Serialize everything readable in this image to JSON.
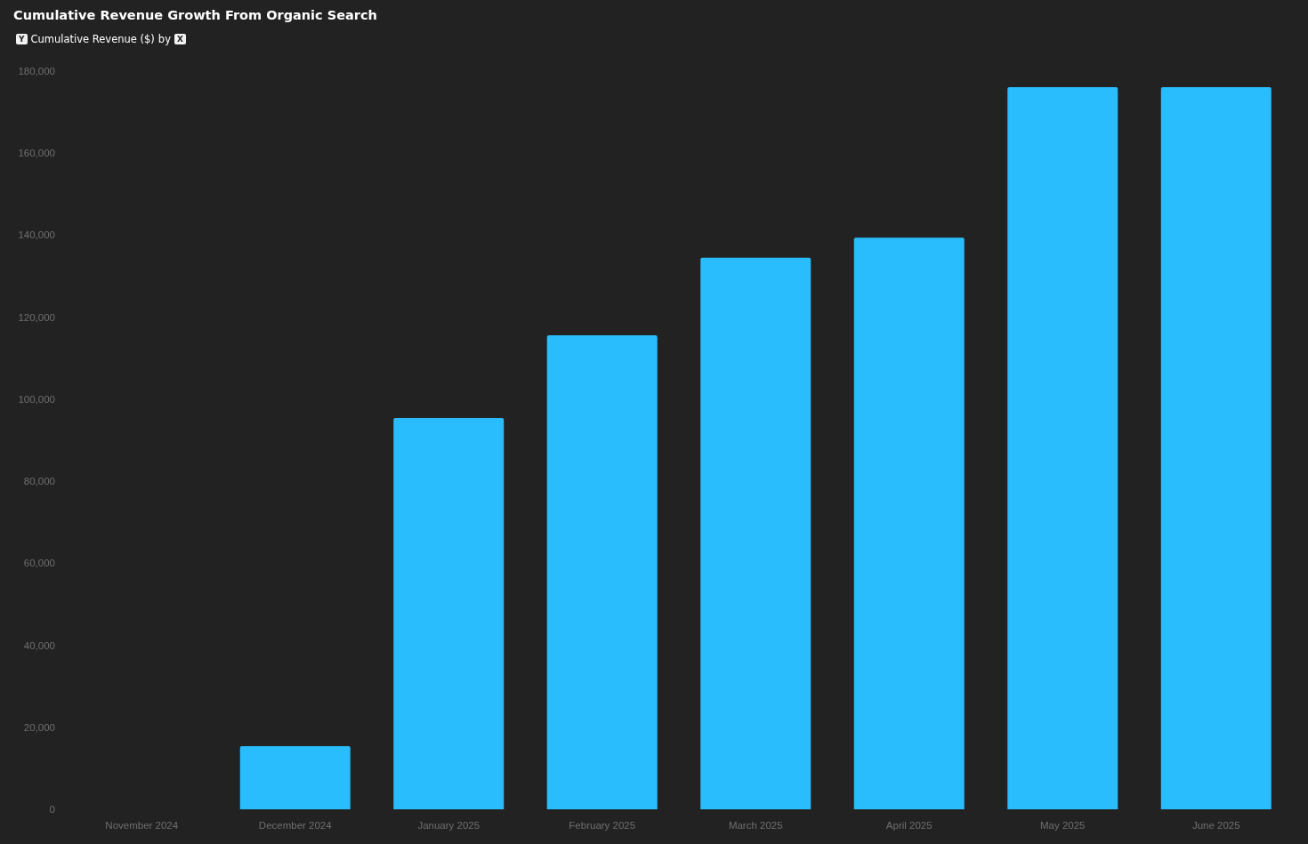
{
  "title": "Cumulative Revenue Growth From Organic Search",
  "legend": {
    "y_badge": "Y",
    "by_text": "by",
    "x_badge": "X"
  },
  "chart_data": {
    "type": "bar",
    "categories": [
      "November 2024",
      "December 2024",
      "January 2025",
      "February 2025",
      "March 2025",
      "April 2025",
      "May 2025",
      "June 2025"
    ],
    "series": [
      {
        "name": "Cumulative Revenue ($)",
        "color": "#29bdfd",
        "values": [
          0,
          15400,
          95400,
          115600,
          134500,
          139400,
          176100,
          176100
        ]
      }
    ],
    "ylim": [
      0,
      180000
    ],
    "yticks": [
      {
        "value": 0,
        "label": "0"
      },
      {
        "value": 20000,
        "label": "20,000"
      },
      {
        "value": 40000,
        "label": "40,000"
      },
      {
        "value": 60000,
        "label": "60,000"
      },
      {
        "value": 80000,
        "label": "80,000"
      },
      {
        "value": 100000,
        "label": "100,000"
      },
      {
        "value": 120000,
        "label": "120,000"
      },
      {
        "value": 140000,
        "label": "140,000"
      },
      {
        "value": 160000,
        "label": "160,000"
      },
      {
        "value": 180000,
        "label": "180,000"
      }
    ]
  }
}
